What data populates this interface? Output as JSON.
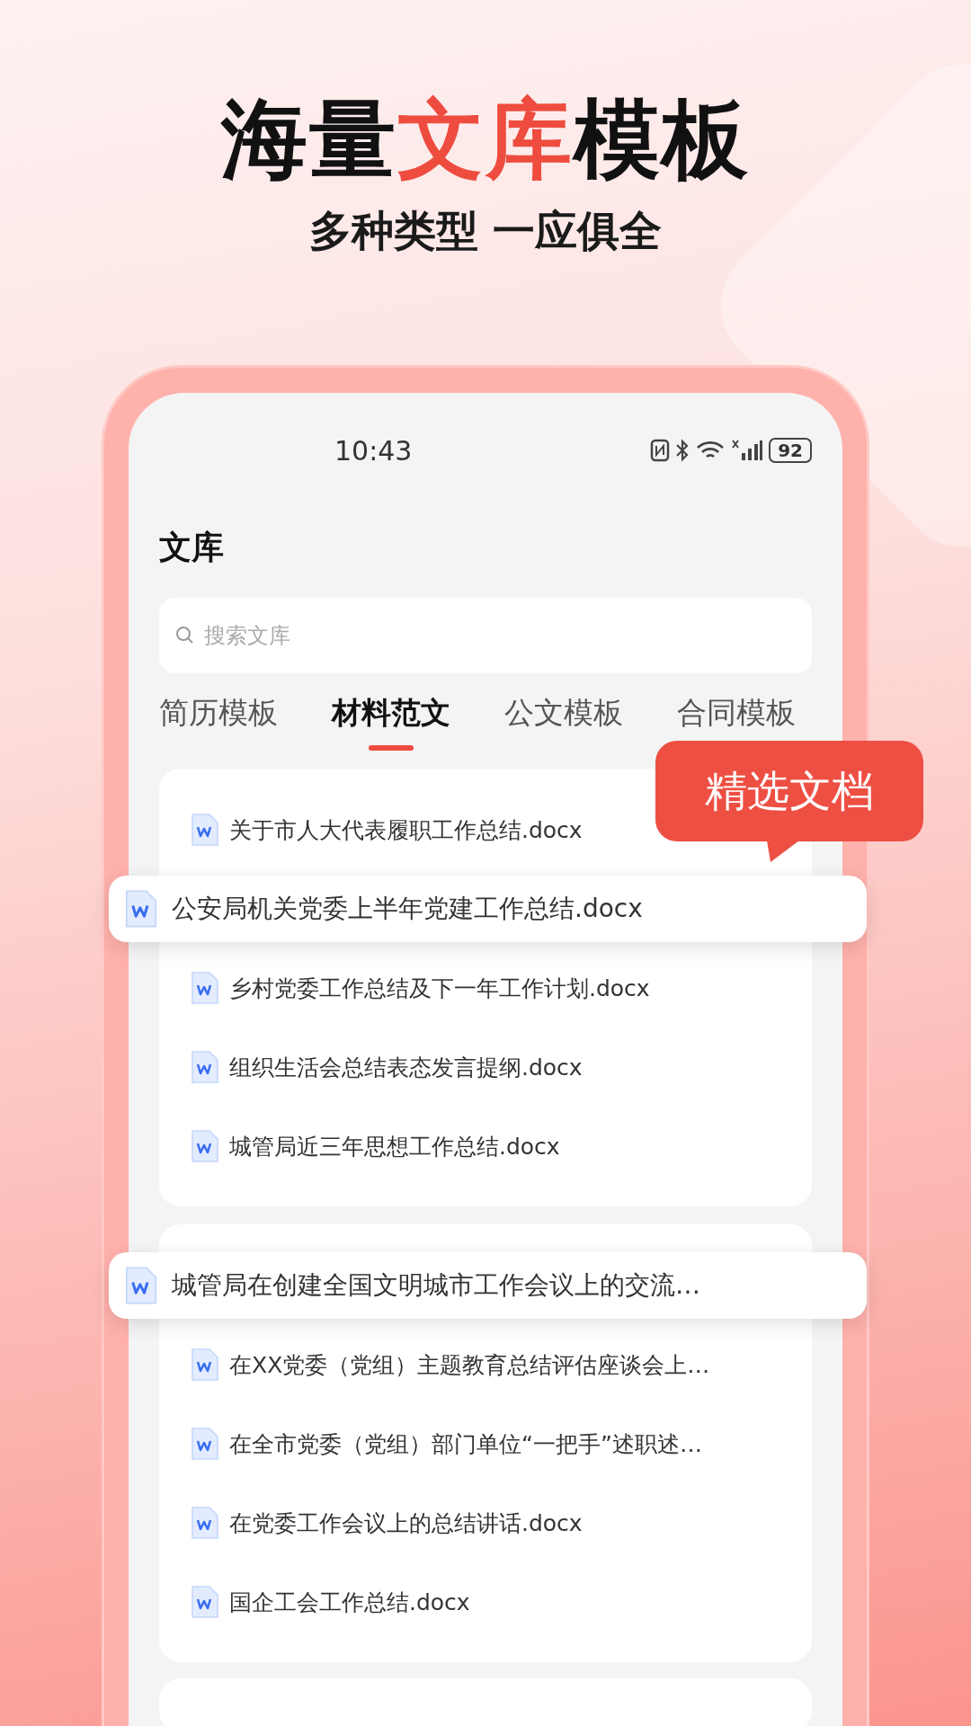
{
  "hero": {
    "headline": [
      {
        "text": "海量",
        "accent": false
      },
      {
        "text": "文库",
        "accent": true
      },
      {
        "text": "模板",
        "accent": false
      }
    ],
    "subtitle": "多种类型 一应俱全"
  },
  "status_bar": {
    "time": "10:43",
    "battery": "92"
  },
  "page_title": "文库",
  "search": {
    "placeholder": "搜索文库"
  },
  "tabs": [
    {
      "label": "简历模板",
      "selected": false
    },
    {
      "label": "材料范文",
      "selected": true
    },
    {
      "label": "公文模板",
      "selected": false
    },
    {
      "label": "合同模板",
      "selected": false
    }
  ],
  "callout": "精选文档",
  "cards": [
    {
      "items": [
        {
          "name": "关于市人大代表履职工作总结.docx",
          "featured": false
        },
        {
          "name": "公安局机关党委上半年党建工作总结.docx",
          "featured": true
        },
        {
          "name": "乡村党委工作总结及下一年工作计划.docx",
          "featured": false
        },
        {
          "name": "组织生活会总结表态发言提纲.docx",
          "featured": false
        },
        {
          "name": "城管局近三年思想工作总结.docx",
          "featured": false
        }
      ]
    },
    {
      "items": [
        {
          "name": "城管局在创建全国文明城市工作会议上的交流…",
          "featured": true
        },
        {
          "name": "在XX党委（党组）主题教育总结评估座谈会上…",
          "featured": false
        },
        {
          "name": "在全市党委（党组）部门单位“一把手”述职述…",
          "featured": false
        },
        {
          "name": "在党委工作会议上的总结讲话.docx",
          "featured": false
        },
        {
          "name": "国企工会工作总结.docx",
          "featured": false
        }
      ]
    }
  ]
}
